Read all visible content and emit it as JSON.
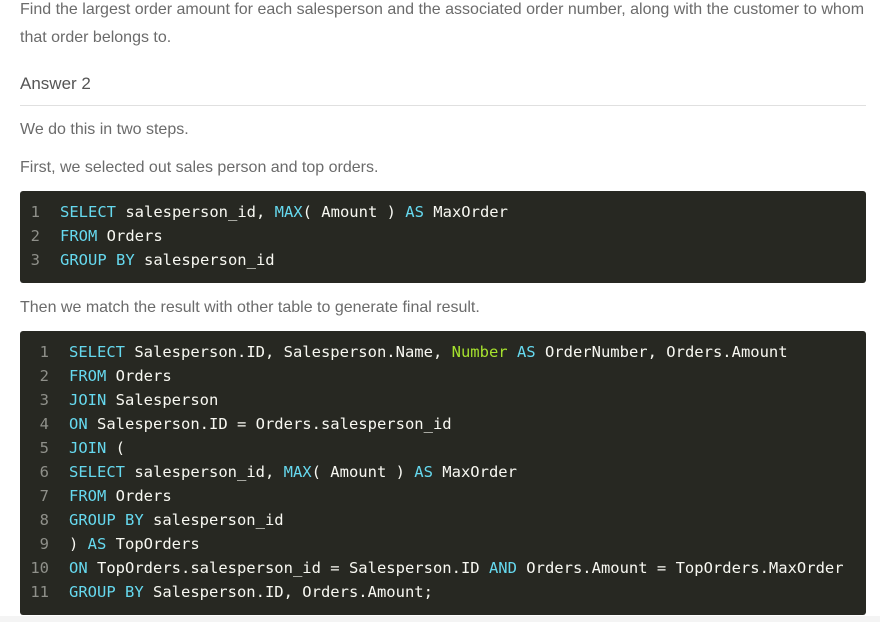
{
  "intro_text": "Find the largest order amount for each salesperson and the associated order number, along with the customer to whom that order belongs to.",
  "heading": "Answer 2",
  "step_intro": "We do this in two steps.",
  "step1_text": "First, we selected out sales person and top orders.",
  "step2_text": "Then we match the result with other table to generate final result.",
  "code1": {
    "line_numbers": [
      "1",
      "2",
      "3"
    ],
    "lines": [
      [
        {
          "t": "SELECT",
          "c": "kw"
        },
        {
          "t": " salesperson_id, ",
          "c": ""
        },
        {
          "t": "MAX",
          "c": "fn"
        },
        {
          "t": "( Amount ) ",
          "c": ""
        },
        {
          "t": "AS",
          "c": "kw"
        },
        {
          "t": " MaxOrder",
          "c": ""
        }
      ],
      [
        {
          "t": "FROM",
          "c": "kw"
        },
        {
          "t": " Orders",
          "c": ""
        }
      ],
      [
        {
          "t": "GROUP BY",
          "c": "kw"
        },
        {
          "t": " salesperson_id",
          "c": ""
        }
      ]
    ]
  },
  "code2": {
    "line_numbers": [
      "1",
      "2",
      "3",
      "4",
      "5",
      "6",
      "7",
      "8",
      "9",
      "10",
      "11"
    ],
    "lines": [
      [
        {
          "t": "SELECT",
          "c": "kw"
        },
        {
          "t": " Salesperson.ID, Salesperson.Name, ",
          "c": ""
        },
        {
          "t": "Number",
          "c": "num"
        },
        {
          "t": " ",
          "c": ""
        },
        {
          "t": "AS",
          "c": "kw"
        },
        {
          "t": " OrderNumber, Orders.Amount",
          "c": ""
        }
      ],
      [
        {
          "t": "FROM",
          "c": "kw"
        },
        {
          "t": " Orders",
          "c": ""
        }
      ],
      [
        {
          "t": "JOIN",
          "c": "kw"
        },
        {
          "t": " Salesperson",
          "c": ""
        }
      ],
      [
        {
          "t": "ON",
          "c": "kw"
        },
        {
          "t": " Salesperson.ID = Orders.salesperson_id",
          "c": ""
        }
      ],
      [
        {
          "t": "JOIN",
          "c": "kw"
        },
        {
          "t": " (",
          "c": ""
        }
      ],
      [
        {
          "t": "SELECT",
          "c": "kw"
        },
        {
          "t": " salesperson_id, ",
          "c": ""
        },
        {
          "t": "MAX",
          "c": "fn"
        },
        {
          "t": "( Amount ) ",
          "c": ""
        },
        {
          "t": "AS",
          "c": "kw"
        },
        {
          "t": " MaxOrder",
          "c": ""
        }
      ],
      [
        {
          "t": "FROM",
          "c": "kw"
        },
        {
          "t": " Orders",
          "c": ""
        }
      ],
      [
        {
          "t": "GROUP BY",
          "c": "kw"
        },
        {
          "t": " salesperson_id",
          "c": ""
        }
      ],
      [
        {
          "t": ") ",
          "c": ""
        },
        {
          "t": "AS",
          "c": "kw"
        },
        {
          "t": " TopOrders",
          "c": ""
        }
      ],
      [
        {
          "t": "ON",
          "c": "kw"
        },
        {
          "t": " TopOrders.salesperson_id = Salesperson.ID ",
          "c": ""
        },
        {
          "t": "AND",
          "c": "kw"
        },
        {
          "t": " Orders.Amount = TopOrders.MaxOrder",
          "c": ""
        }
      ],
      [
        {
          "t": "GROUP BY",
          "c": "kw"
        },
        {
          "t": " Salesperson.ID, Orders.Amount;",
          "c": ""
        }
      ]
    ]
  },
  "colors": {
    "code_background": "#272822",
    "keyword": "#66d9ef",
    "number_keyword": "#a6e22e",
    "code_text": "#f8f8f2",
    "line_number": "#8f908a"
  }
}
